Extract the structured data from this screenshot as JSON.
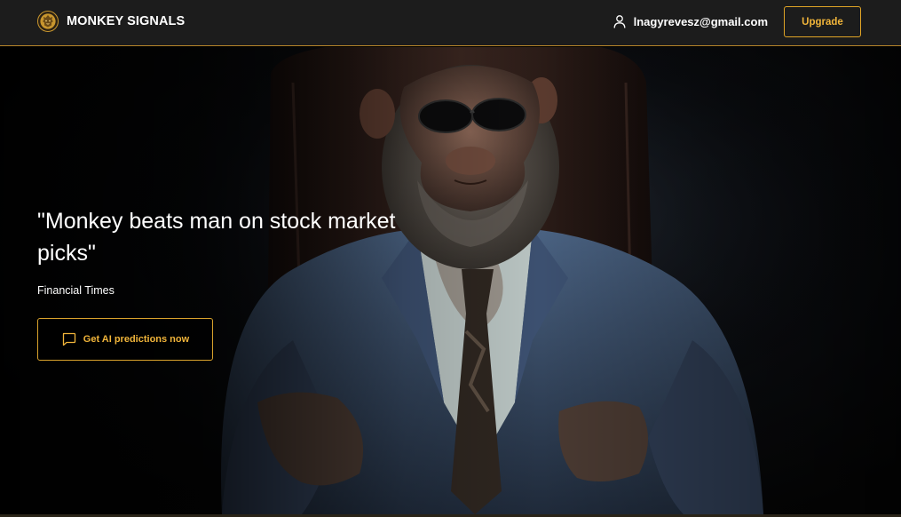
{
  "header": {
    "brand_name": "MONKEY SIGNALS",
    "logo_icon": "lion-crest-icon",
    "user_icon": "user-icon",
    "user_email": "lnagyrevesz@gmail.com",
    "upgrade_label": "Upgrade"
  },
  "hero": {
    "headline": "\"Monkey beats man on stock market picks\"",
    "source": "Financial Times",
    "cta_icon": "chat-bubble-icon",
    "cta_label": "Get AI predictions now",
    "image": "monkey-in-suit-photo"
  },
  "colors": {
    "accent": "#e0a426",
    "header_bg": "#1c1c1c",
    "page_bg": "#000000",
    "text": "#ffffff"
  }
}
